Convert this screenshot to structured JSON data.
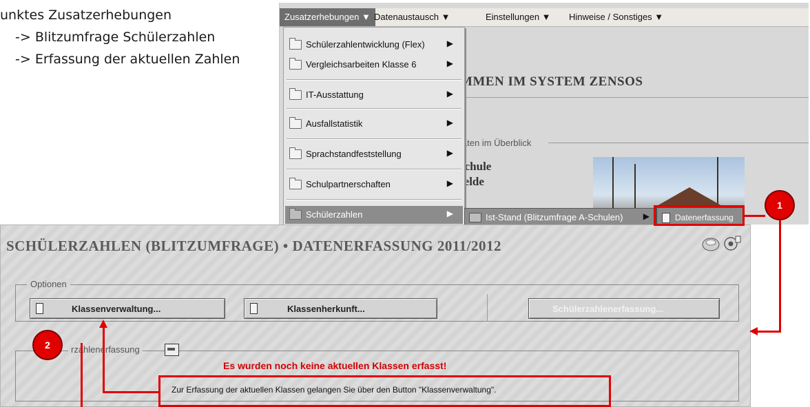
{
  "notes": {
    "line1": "unktes Zusatzerhebungen",
    "line2": "-> Blitzumfrage Schülerzahlen",
    "line3": "-> Erfassung der aktuellen Zahlen"
  },
  "menubar": {
    "items": [
      "Zusatzerhebungen ▼",
      "Datenaustausch ▼",
      "Einstellungen ▼",
      "Hinweise / Sonstiges ▼"
    ]
  },
  "background": {
    "heading": "MMEN IM SYSTEM ZENSOS",
    "legend": "laten im Überblick",
    "school_line1": "schule",
    "school_line2": "felde"
  },
  "dropdown": {
    "items": [
      "Schülerzahlentwicklung (Flex)",
      "Vergleichsarbeiten Klasse 6",
      "IT-Ausstattung",
      "Ausfallstatistik",
      "Sprachstandfeststellung",
      "Schulpartnerschaften",
      "Schülerzahlen"
    ],
    "arrow": "▶"
  },
  "submenu": {
    "item": "Ist-Stand (Blitzumfrage A-Schulen)",
    "item2": "Datenerfassung"
  },
  "panel": {
    "title": "SCHÜLERZAHLEN (BLITZUMFRAGE) •  DATENERFASSUNG 2011/2012",
    "options_legend": "Optionen",
    "btn_klassenverwaltung": "Klassenverwaltung...",
    "btn_klassenherkunft": "Klassenherkunft...",
    "btn_schuelerzahlenerfassung": "Schülerzahlenerfassung...",
    "section_legend": "rzahlenerfassung",
    "warning": "Es wurden noch keine aktuellen Klassen erfasst!",
    "hint": "Zur Erfassung der aktuellen Klassen gelangen Sie über den Button \"Klassenverwaltung\"."
  },
  "annotations": {
    "marker1": "1",
    "marker2": "2",
    "color": "#e00000"
  }
}
